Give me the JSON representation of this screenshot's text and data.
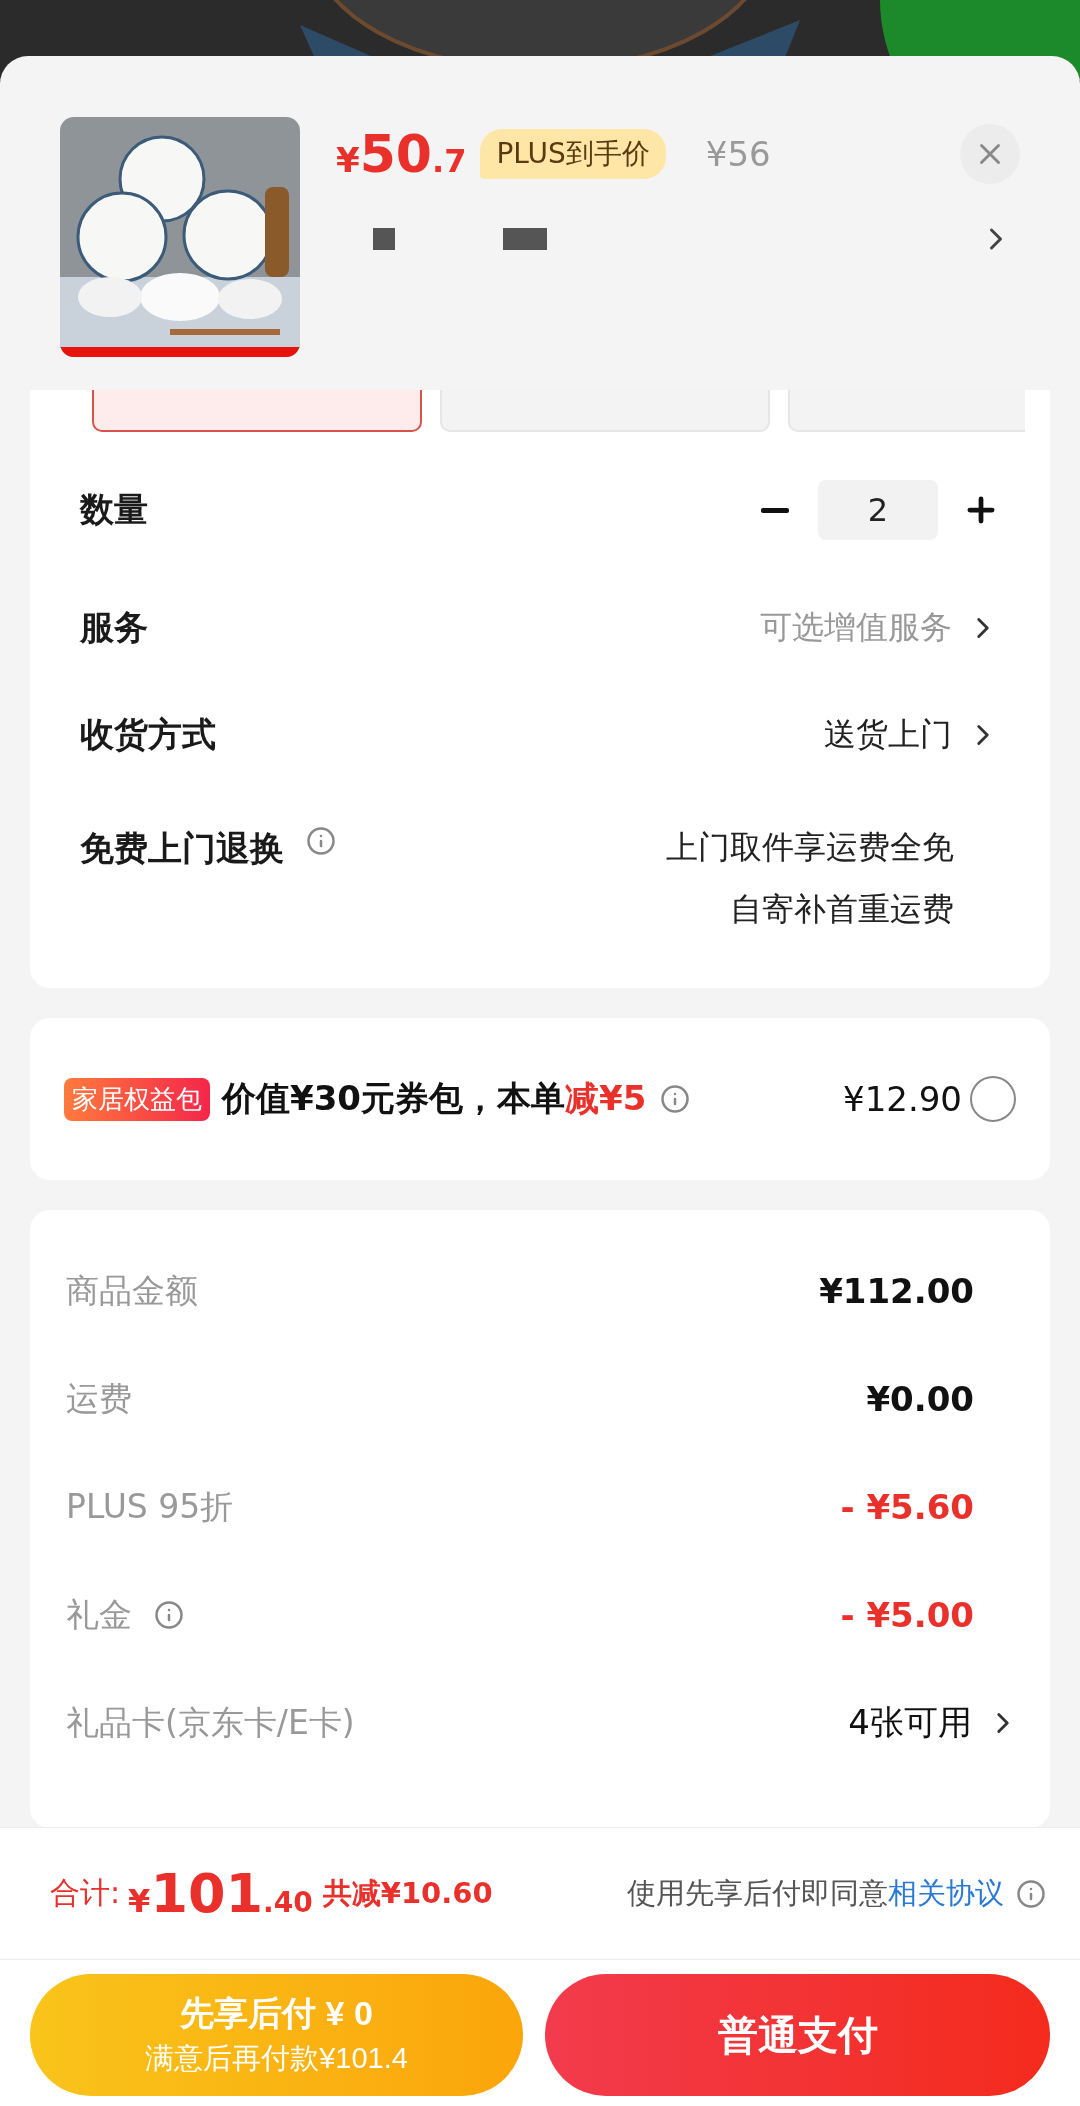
{
  "header": {
    "price": {
      "symbol": "¥",
      "integer": "50",
      "decimal": ".7"
    },
    "badge": "PLUS到手价",
    "original_price": "¥56"
  },
  "variant_chips": [
    {
      "selected": true
    },
    {
      "selected": false
    },
    {
      "selected": false
    }
  ],
  "options": [
    {
      "kind": "quantity",
      "label": "数量",
      "value": "2"
    },
    {
      "kind": "link",
      "label": "服务",
      "value": "可选增值服务",
      "muted": true
    },
    {
      "kind": "link",
      "label": "收货方式",
      "value": "送货上门",
      "muted": false
    },
    {
      "kind": "info",
      "label": "免费上门退换",
      "lines": [
        "上门取件享运费全免",
        "自寄补首重运费"
      ]
    }
  ],
  "promo": {
    "tag": "家居权益包",
    "text": "价值¥30元券包，本单",
    "highlight": "减¥5",
    "price": "¥12.90",
    "checked": false
  },
  "summary": {
    "rows": [
      {
        "kind": "amount",
        "label": "商品金额",
        "value": "¥112.00",
        "info": false
      },
      {
        "kind": "amount",
        "label": "运费",
        "value": "¥0.00",
        "info": false
      },
      {
        "kind": "discount",
        "label": "PLUS 95折",
        "value": "- ¥5.60",
        "info": false
      },
      {
        "kind": "discount",
        "label": "礼金",
        "value": "- ¥5.00",
        "info": true
      },
      {
        "kind": "link",
        "label": "礼品卡(京东卡/E卡)",
        "value": "4张可用",
        "info": false
      }
    ]
  },
  "footer": {
    "total_label": "合计:",
    "total": {
      "symbol": "¥",
      "integer": "101",
      "decimal": ".40"
    },
    "saved": "共减¥10.60",
    "agreement": {
      "text": "使用先享后付即同意",
      "link": "相关协议"
    },
    "pay_later": {
      "title": "先享后付 ¥ 0",
      "subtitle": "满意后再付款¥101.4"
    },
    "pay": {
      "label": "普通支付"
    }
  }
}
